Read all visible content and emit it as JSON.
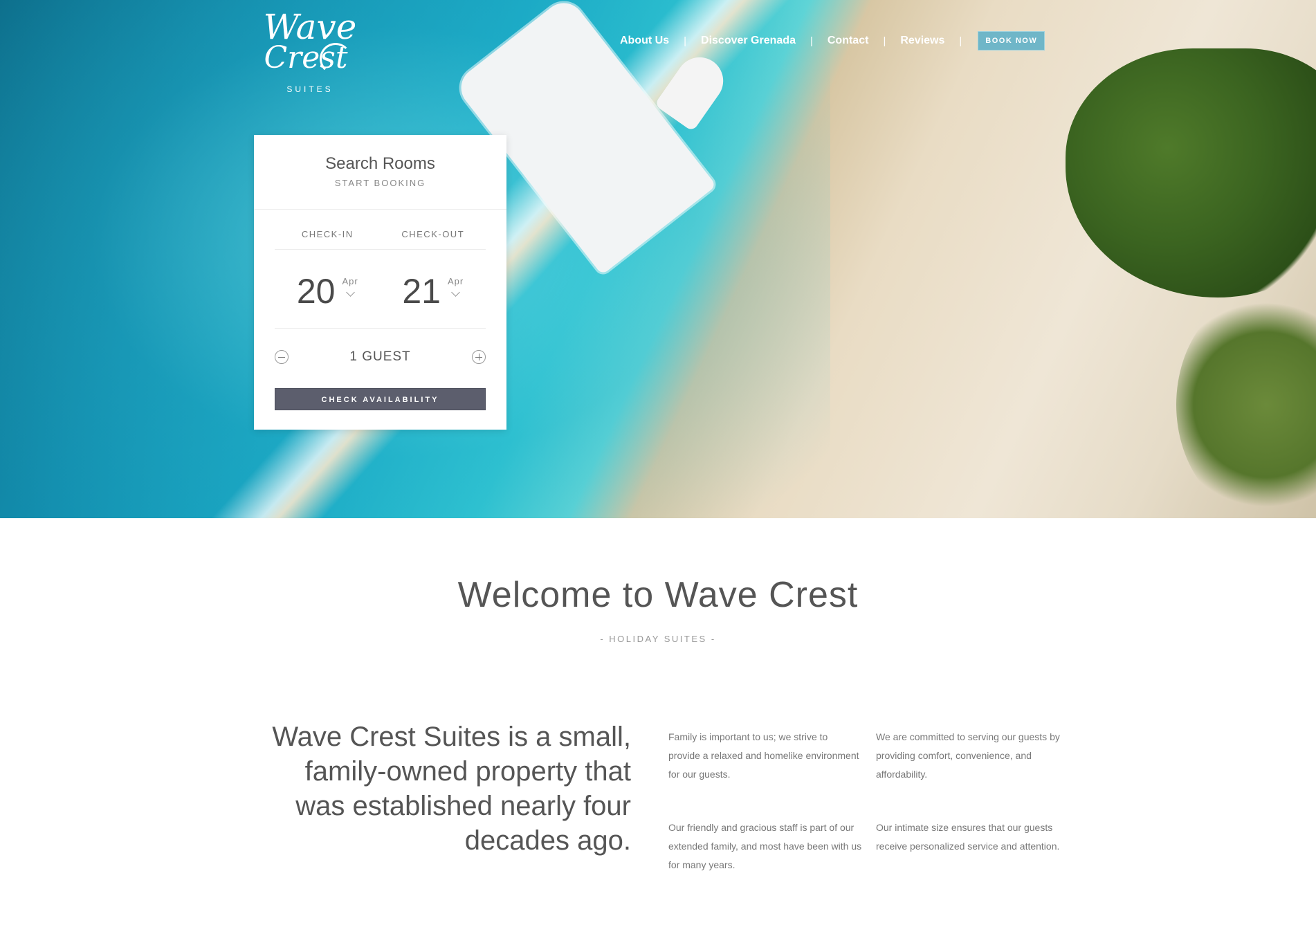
{
  "brand": {
    "logo_line1": "Wave",
    "logo_line2": "Crest",
    "logo_sub": "SUITES"
  },
  "nav": {
    "items": [
      "About Us",
      "Discover Grenada",
      "Contact",
      "Reviews"
    ],
    "book_label": "BOOK NOW"
  },
  "booking": {
    "title": "Search Rooms",
    "subtitle": "START BOOKING",
    "checkin_label": "CHECK-IN",
    "checkout_label": "CHECK-OUT",
    "checkin_day": "20",
    "checkin_month": "Apr",
    "checkout_day": "21",
    "checkout_month": "Apr",
    "guests_label": "1 GUEST",
    "button_label": "CHECK AVAILABILITY"
  },
  "welcome": {
    "title": "Welcome to Wave Crest",
    "subtitle": "- HOLIDAY SUITES -"
  },
  "intro": {
    "lead": "Wave Crest Suites is a small, family-owned property that was established nearly four decades ago.",
    "p1": "Family is important to us; we strive to provide a relaxed and homelike environment for our guests.",
    "p2": "We are committed to serving our guests by providing comfort, convenience, and affordability.",
    "p3": "Our friendly and gracious staff is part of our extended family, and most have been with us for many years.",
    "p4": "Our intimate size ensures that our guests receive personalized service and attention."
  },
  "colors": {
    "book_button": "#6fb6c8",
    "check_button": "#5c5e6d"
  }
}
